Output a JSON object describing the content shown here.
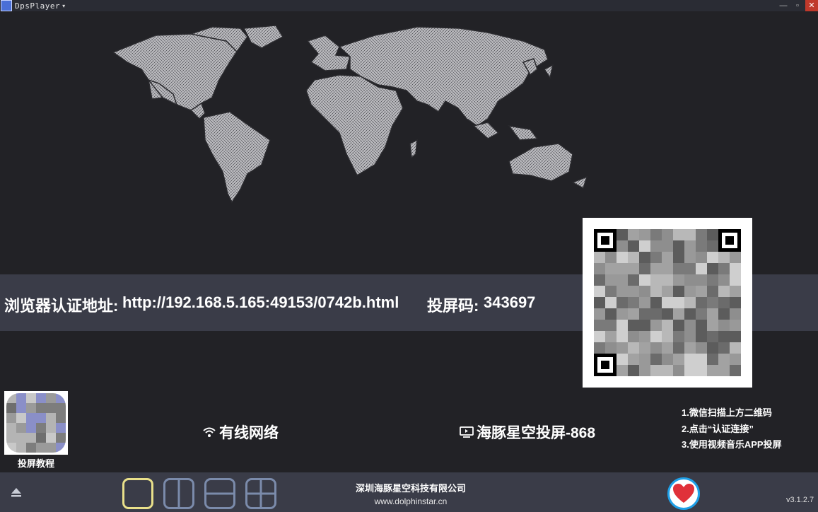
{
  "window": {
    "title": "DpsPlayer",
    "caret": "▾",
    "minimize": "—",
    "maximize": "▫",
    "close": "✕"
  },
  "info": {
    "auth_label": "浏览器认证地址:",
    "auth_url": "http://192.168.5.165:49153/0742b.html",
    "code_label": "投屏码:",
    "code_value": "343697"
  },
  "tutorial": {
    "label": "投屏教程"
  },
  "network": {
    "icon": "wifi-icon",
    "label": "有线网络"
  },
  "device": {
    "icon": "tv-icon",
    "name": "海豚星空投屏-868"
  },
  "steps": [
    "1.微信扫描上方二维码",
    "2.点击“认证连接”",
    "3.使用视频音乐APP投屏"
  ],
  "bottom": {
    "company": "深圳海豚星空科技有限公司",
    "website": "www.dolphinstar.cn",
    "version": "v3.1.2.7",
    "layouts": [
      "single",
      "split-vertical",
      "split-horizontal",
      "quad"
    ],
    "active_layout": "single"
  },
  "colors": {
    "background": "#222226",
    "band": "#3a3c48",
    "active_layout": "#e9e08a",
    "layout_border": "#7b8bab",
    "heart_ring": "#1fa0e8",
    "heart": "#e0313a"
  }
}
